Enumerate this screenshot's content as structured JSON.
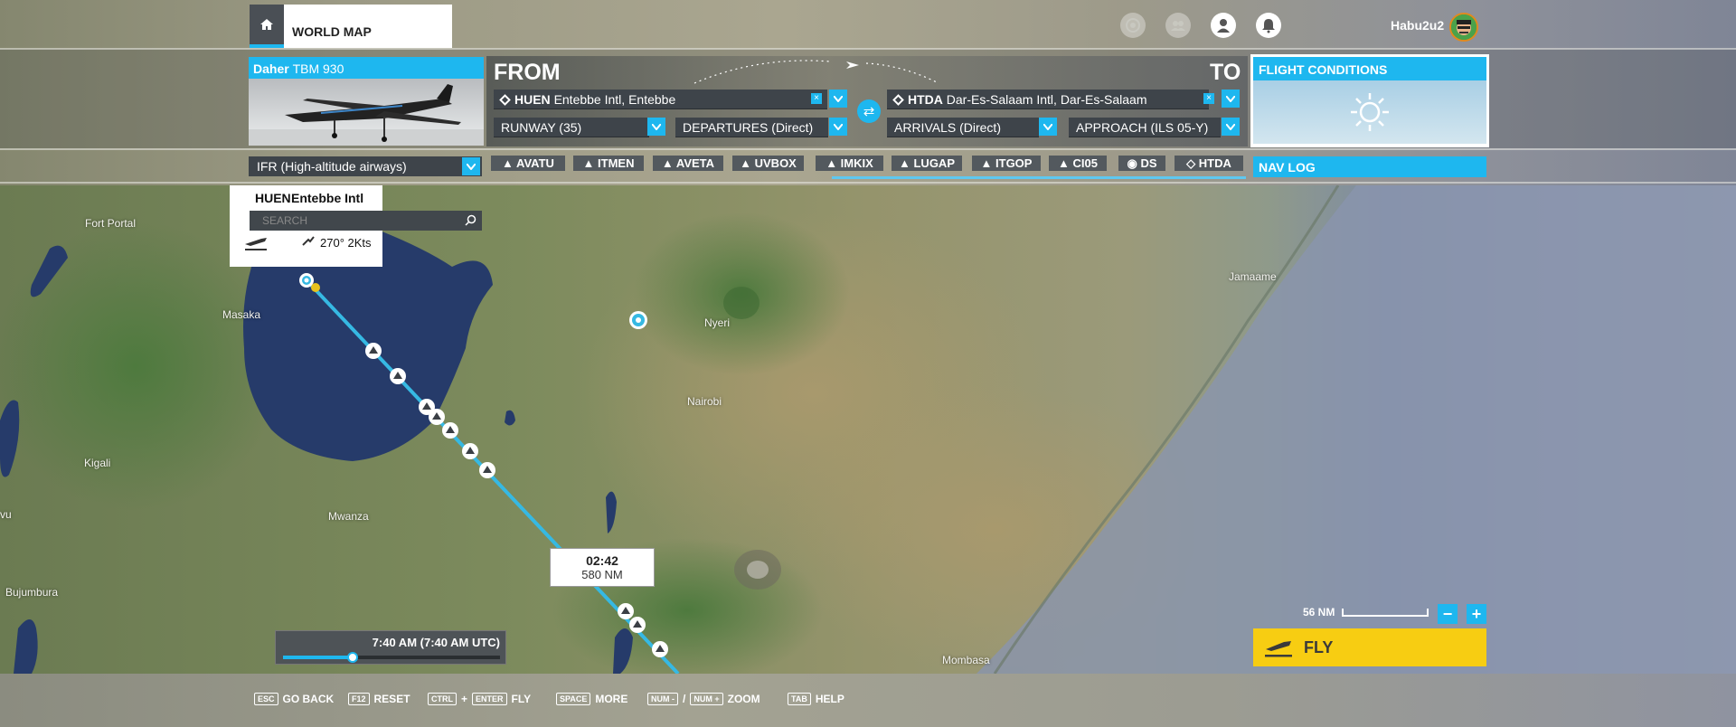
{
  "header": {
    "tab_label": "WORLD MAP",
    "username": "Habu2u2",
    "icons": [
      "home-icon",
      "target-icon",
      "group-icon",
      "profile-icon",
      "notifications-icon"
    ]
  },
  "aircraft": {
    "maker": "Daher",
    "model": "TBM 930"
  },
  "route": {
    "from_label": "FROM",
    "to_label": "TO",
    "departure_code": "HUEN",
    "departure_name": "Entebbe Intl, Entebbe",
    "arrival_code": "HTDA",
    "arrival_name": "Dar-Es-Salaam Intl, Dar-Es-Salaam",
    "runway": "RUNWAY (35)",
    "departures": "DEPARTURES (Direct)",
    "arrivals": "ARRIVALS (Direct)",
    "approach": "APPROACH (ILS 05-Y)"
  },
  "flight_conditions": {
    "title": "FLIGHT CONDITIONS",
    "weather_icon": "sun-icon"
  },
  "flight_plan": {
    "type": "IFR (High-altitude airways)",
    "waypoints": [
      "AVATU",
      "ITMEN",
      "AVETA",
      "UVBOX",
      "IMKIX",
      "LUGAP",
      "ITGOP",
      "CI05",
      "DS",
      "HTDA"
    ]
  },
  "nav_log_label": "NAV LOG",
  "airport_card": {
    "code": "HUEN",
    "name": "Entebbe Intl",
    "search_placeholder": "SEARCH",
    "wind": "270° 2Kts"
  },
  "map_labels": {
    "fort_portal": "Fort Portal",
    "masaka": "Masaka",
    "kigali": "Kigali",
    "mwanza": "Mwanza",
    "bujumbura": "Bujumbura",
    "vu": "vu",
    "nyeri": "Nyeri",
    "nairobi": "Nairobi",
    "jamaame": "Jamaame",
    "mombasa": "Mombasa"
  },
  "eta": {
    "time": "02:42",
    "distance": "580 NM"
  },
  "time_of_day": {
    "label": "7:40 AM (7:40 AM UTC)",
    "progress": 0.32
  },
  "map_scale": "56 NM",
  "fly_label": "FLY",
  "hotkeys": [
    {
      "keys": [
        "ESC"
      ],
      "label": "GO BACK"
    },
    {
      "keys": [
        "F12"
      ],
      "label": "RESET"
    },
    {
      "keys": [
        "CTRL",
        "ENTER"
      ],
      "sep": "+",
      "label": "FLY"
    },
    {
      "keys": [
        "SPACE"
      ],
      "label": "MORE"
    },
    {
      "keys": [
        "NUM -",
        "NUM +"
      ],
      "sep": "/",
      "label": "ZOOM"
    },
    {
      "keys": [
        "TAB"
      ],
      "label": "HELP"
    }
  ],
  "colors": {
    "accent": "#1eb7ef",
    "fly_button": "#f7cd12",
    "route_line": "#36b9e3",
    "lake": "#263b6a"
  }
}
